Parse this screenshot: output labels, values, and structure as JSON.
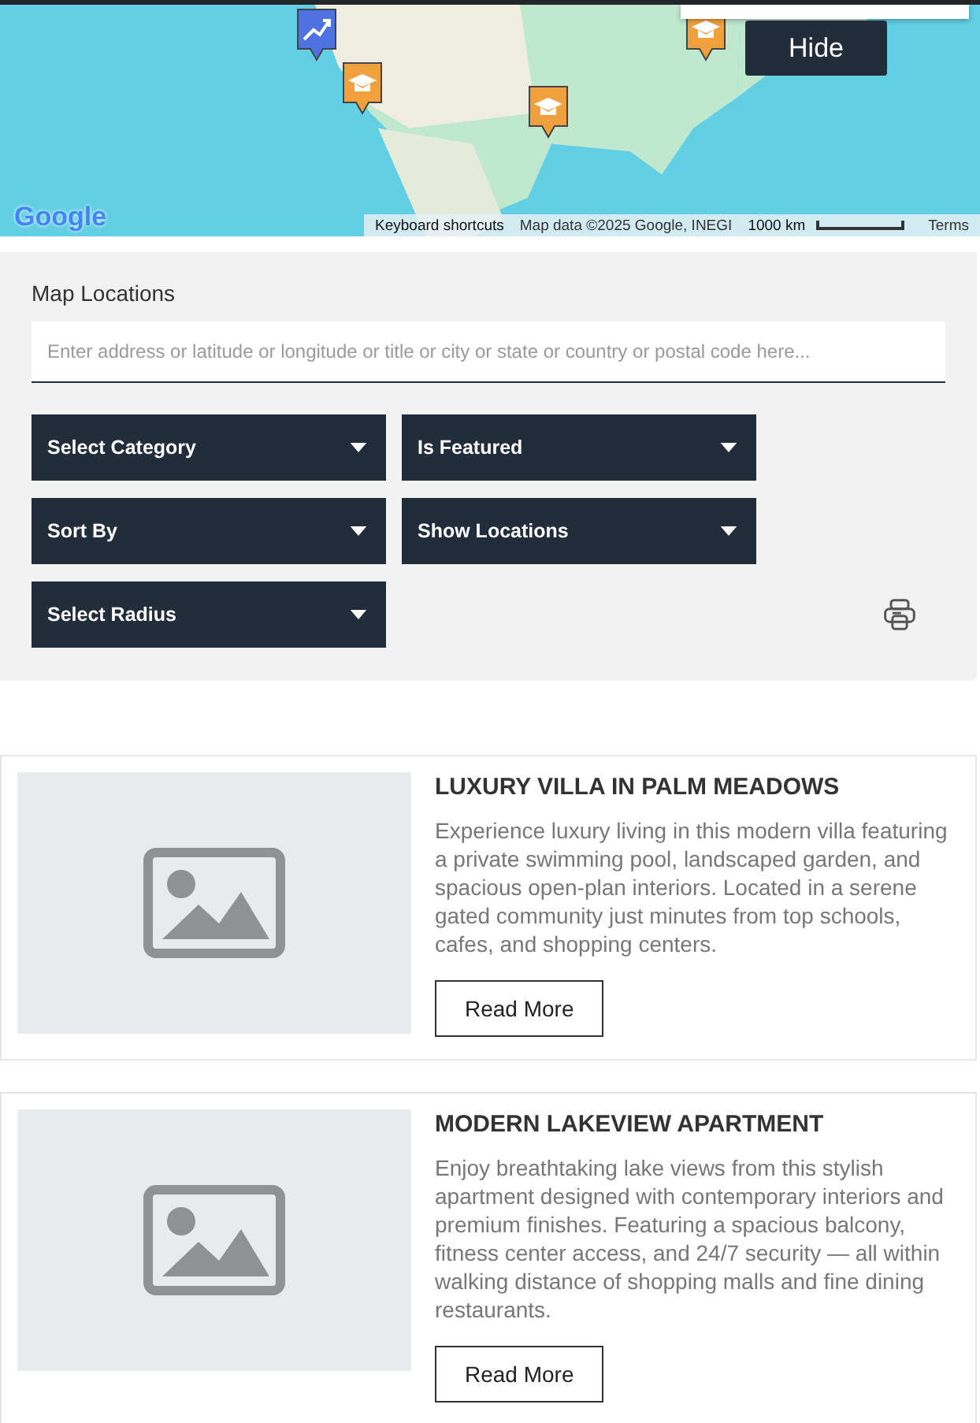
{
  "map": {
    "logo": "Google",
    "hide_button": "Hide",
    "attribution": [
      "Keyboard shortcuts",
      "Map data ©2025 Google, INEGI"
    ],
    "scale": "1000 km",
    "terms": "Terms",
    "markers": [
      {
        "kind": "chart"
      },
      {
        "kind": "school"
      },
      {
        "kind": "school"
      },
      {
        "kind": "school"
      }
    ]
  },
  "filters": {
    "title": "Map Locations",
    "search": {
      "placeholder": "Enter address or latitude or longitude or title or city or state or country or postal code here..."
    },
    "dropdowns": [
      {
        "label": "Select Category"
      },
      {
        "label": "Is Featured"
      },
      {
        "label": "Sort By"
      },
      {
        "label": "Show Locations"
      },
      {
        "label": "Select Radius"
      }
    ]
  },
  "listings": [
    {
      "title": "LUXURY VILLA IN PALM MEADOWS",
      "description": "Experience luxury living in this modern villa featuring a private swimming pool, landscaped garden, and spacious open-plan interiors. Located in a serene gated community just minutes from top schools, cafes, and shopping centers.",
      "button": "Read More"
    },
    {
      "title": "MODERN LAKEVIEW APARTMENT",
      "description": "Enjoy breathtaking lake views from this stylish apartment designed with contemporary interiors and premium finishes. Featuring a spacious balcony, fitness center access, and 24/7 security — all within walking distance of shopping malls and fine dining restaurants.",
      "button": "Read More"
    }
  ]
}
